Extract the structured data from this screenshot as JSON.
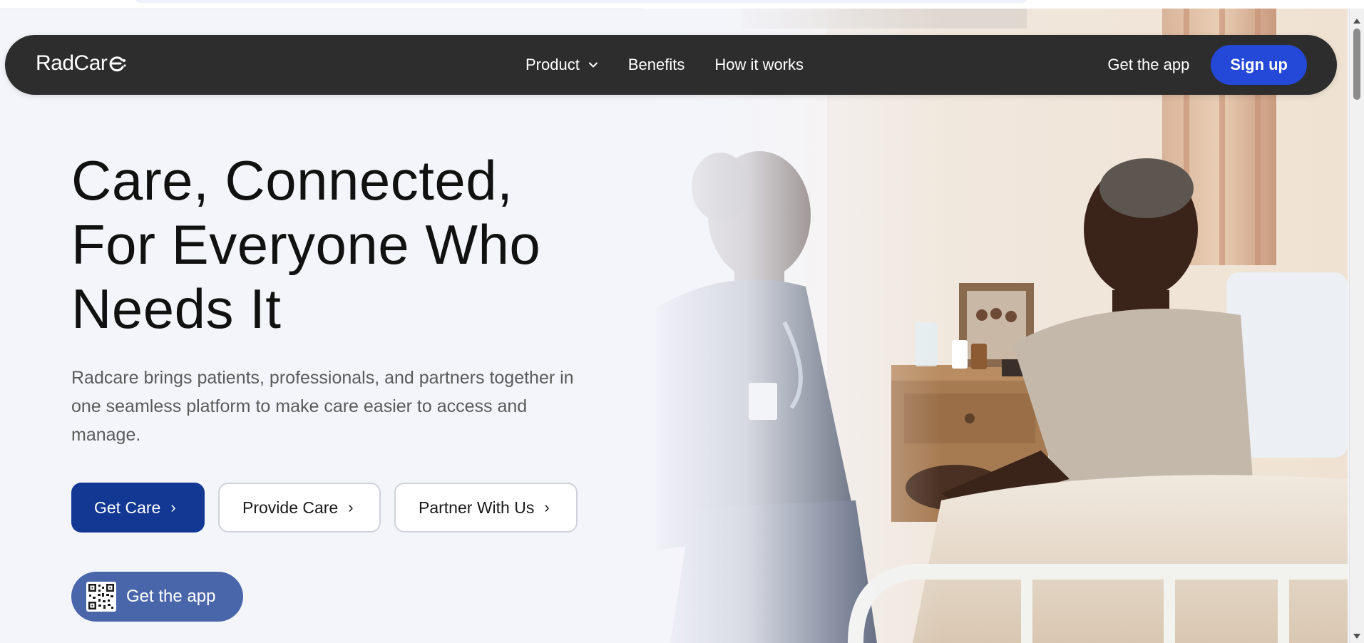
{
  "brand": {
    "name": "RadCar",
    "mark": "e"
  },
  "nav": {
    "items": [
      {
        "label": "Product",
        "has_dropdown": true
      },
      {
        "label": "Benefits"
      },
      {
        "label": "How it works"
      }
    ],
    "get_app_label": "Get the app",
    "signup_label": "Sign up"
  },
  "hero": {
    "title_lines": [
      "Care, Connected,",
      "For Everyone Who",
      "Needs It"
    ],
    "description_lines": [
      "Radcare brings patients, professionals, and partners together in",
      "one seamless platform to make care easier to access and",
      "manage."
    ],
    "buttons": [
      {
        "label": "Get Care",
        "arrow": "›"
      },
      {
        "label": "Provide Care",
        "arrow": "›"
      },
      {
        "label": "Partner With Us",
        "arrow": "›"
      }
    ],
    "get_app_label": "Get the app"
  },
  "colors": {
    "background": "#f4f5fb",
    "navbar": "#2d2d2d",
    "signup": "#2448d8",
    "primary_cta": "#123893",
    "get_app_pill": "#4a66aa"
  },
  "icons": {
    "dropdown": "chevron-down-icon",
    "get_app": "qr-code-icon",
    "logo": "radcare-logo-mark"
  }
}
